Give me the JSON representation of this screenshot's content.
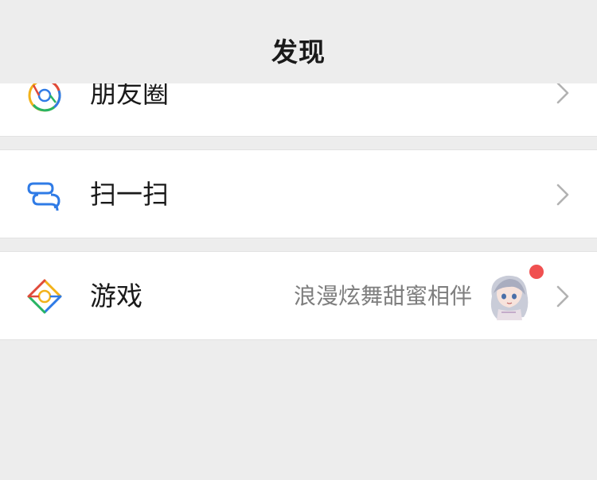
{
  "header": {
    "title": "发现"
  },
  "rows": [
    {
      "label": "朋友圈",
      "icon": "moments-icon"
    },
    {
      "label": "扫一扫",
      "icon": "scan-icon"
    },
    {
      "label": "游戏",
      "icon": "games-icon",
      "subtitle": "浪漫炫舞甜蜜相伴",
      "has_red_dot": true
    }
  ],
  "colors": {
    "background": "#ededed",
    "row_background": "#ffffff",
    "text": "#1a1a1a",
    "subtitle": "#7e7e7e",
    "chevron": "#b2b2b2",
    "scan_blue": "#2f7be6",
    "red_dot": "#f05050"
  }
}
